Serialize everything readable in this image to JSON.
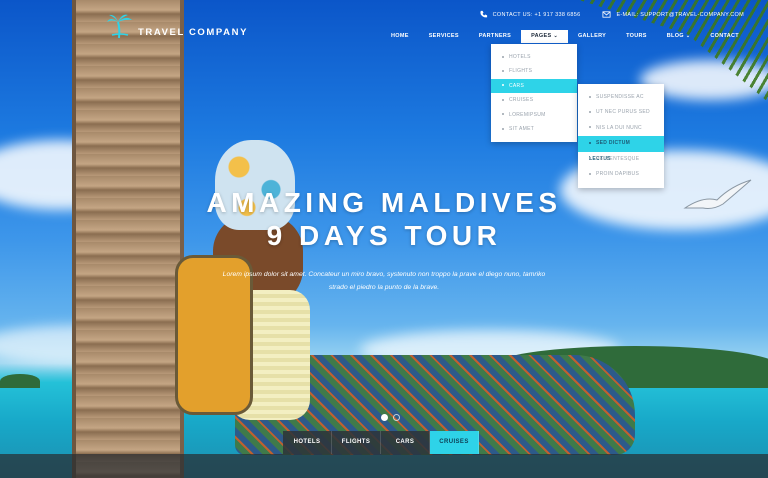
{
  "topbar": {
    "contact": "CONTACT US: +1 917 338 6856",
    "email": "E-MAIL: SUPPORT@TRAVEL-COMPANY.COM"
  },
  "brand": {
    "name": "TRAVEL COMPANY",
    "accent": "#2ed3e8"
  },
  "nav": {
    "items": [
      {
        "label": "HOME"
      },
      {
        "label": "SERVICES"
      },
      {
        "label": "PARTNERS"
      },
      {
        "label": "PAGES"
      },
      {
        "label": "GALLERY"
      },
      {
        "label": "TOURS"
      },
      {
        "label": "BLOG"
      },
      {
        "label": "CONTACT"
      }
    ],
    "active": "PAGES"
  },
  "dropdown": {
    "items": [
      {
        "label": "HOTELS"
      },
      {
        "label": "FLIGHTS"
      },
      {
        "label": "CARS"
      },
      {
        "label": "CRUISES"
      },
      {
        "label": "LOREMIPSUM"
      },
      {
        "label": "SIT AMET"
      }
    ],
    "active": "CARS"
  },
  "submenu": {
    "items": [
      {
        "label": "SUSPENDISSE AC"
      },
      {
        "label": "UT NEC PURUS SED"
      },
      {
        "label": "NIS LA DUI NUNC"
      },
      {
        "label": "SED DICTUM LECTUS"
      },
      {
        "label": "PELLENTESQUE"
      },
      {
        "label": "PROIN DAPIBUS"
      }
    ],
    "active": "SED DICTUM LECTUS"
  },
  "hero": {
    "title_line1": "AMAZING MALDIVES",
    "title_line2": "9 DAYS TOUR",
    "lead_line1": "Lorem ipsum dolor sit amet. Concateur un miro bravo, systenuto non troppo la prave el diego nuno, tamriko",
    "lead_line2": "strado el piedro la punto de la brave."
  },
  "tabs": {
    "items": [
      {
        "label": "HOTELS"
      },
      {
        "label": "FLIGHTS"
      },
      {
        "label": "CARS"
      },
      {
        "label": "CRUISES"
      }
    ],
    "active": "CRUISES"
  },
  "icons": {
    "phone": "phone-icon",
    "mail": "mail-icon",
    "logo": "palm-tree-icon",
    "caret": "chevron-down-icon"
  }
}
